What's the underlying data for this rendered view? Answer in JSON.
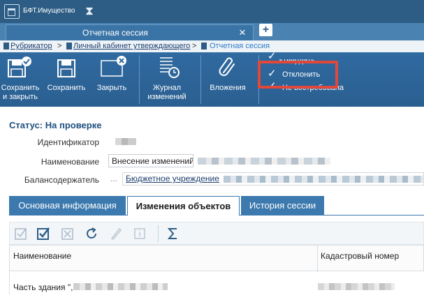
{
  "app": {
    "name": "БФТ.Имущество"
  },
  "tab": {
    "title": "Отчетная сессия",
    "add": "+"
  },
  "breadcrumb": {
    "items": [
      "Рубрикатор",
      "Личный кабинет утверждающего"
    ],
    "current": "Отчетная сессия",
    "separator": ">"
  },
  "toolbar": {
    "save_close": "Сохранить и закрыть",
    "save": "Сохранить",
    "close": "Закрыть",
    "journal": "Журнал изменений",
    "attachments": "Вложения"
  },
  "menu": {
    "approve": "Утвердить",
    "reject": "Отклонить",
    "not_required": "Не востребована"
  },
  "form": {
    "status": "Статус: На проверке",
    "id_label": "Идентификатор",
    "name_label": "Наименование",
    "name_value": "Внесение изменений",
    "holder_label": "Балансодержатель",
    "holder_dots": "...",
    "holder_value": "Бюджетное учреждение"
  },
  "subtabs": [
    "Основная информация",
    "Изменения объектов",
    "История сессии"
  ],
  "grid": {
    "headers": [
      "Наименование",
      "Кадастровый номер"
    ],
    "rows": [
      {
        "name": "Часть здания \","
      }
    ]
  },
  "colors": {
    "appbar": "#2d5d85",
    "toolbar": "#2f6aa0",
    "accent": "#3b79ae",
    "highlight": "#e0483c"
  }
}
